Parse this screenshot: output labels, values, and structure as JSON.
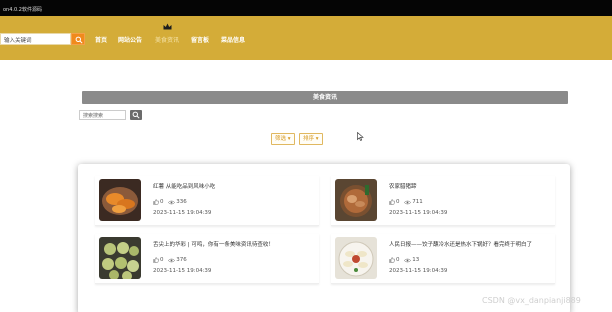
{
  "window": {
    "title": "on4.0.2软件源码"
  },
  "header": {
    "search_placeholder": "输入关键词",
    "nav": [
      "首页",
      "网站公告",
      "美食资讯",
      "留言板",
      "菜品信息"
    ],
    "active_index": 2
  },
  "news": {
    "title": "美食资讯",
    "search_placeholder": "搜索搜索",
    "filter_label": "筛选 ▾",
    "sort_label": "排序 ▾"
  },
  "articles": [
    {
      "title": "红薯 从能吃品到风味小吃",
      "likes": "0",
      "views": "336",
      "date": "2023-11-15 19:04:39"
    },
    {
      "title": "农家腊猪蹄",
      "likes": "0",
      "views": "711",
      "date": "2023-11-15 19:04:39"
    },
    {
      "title": "舌尖上的华彩 | 可鸣，你有一条美味资讯待查收！",
      "likes": "0",
      "views": "376",
      "date": "2023-11-15 19:04:39"
    },
    {
      "title": "人民日报——饺子蘸冷水还是热水下锅好？看完终于明白了",
      "likes": "0",
      "views": "13",
      "date": "2023-11-15 19:04:39"
    }
  ],
  "watermark": "CSDN @vx_danpianji889",
  "colors": {
    "header": "#d4ac38",
    "search_button": "#f08a1c",
    "accent": "#d79a22",
    "news_bar": "#8a8a8a"
  }
}
